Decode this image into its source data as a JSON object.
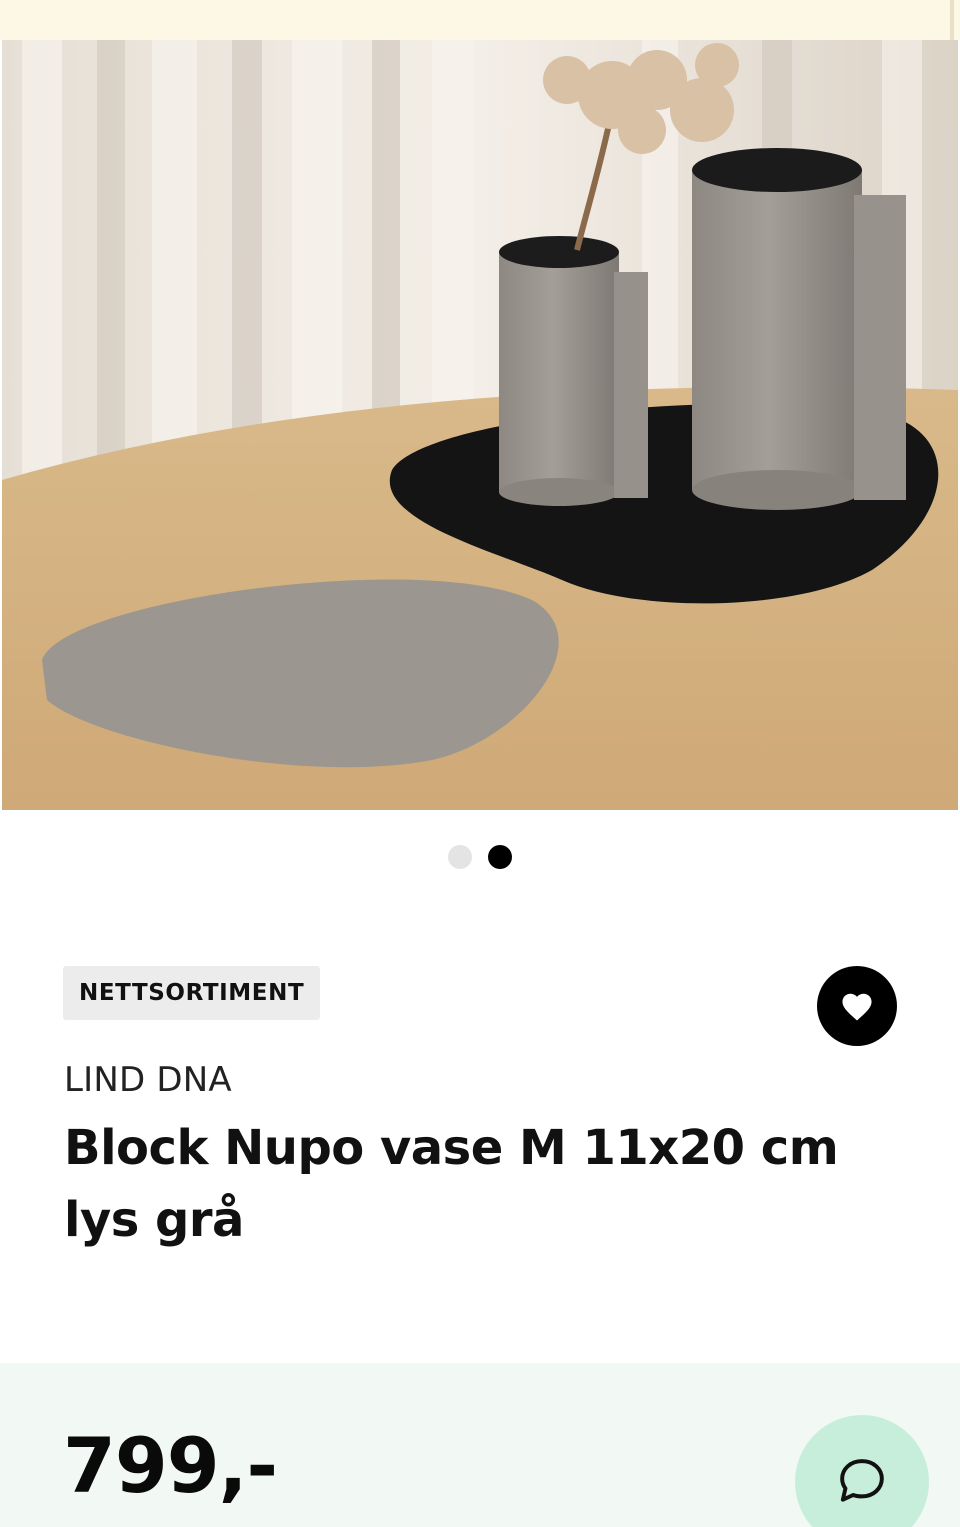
{
  "gallery": {
    "image_description_name": "product-photo",
    "slide_count": 2,
    "active_slide": 2
  },
  "product": {
    "badge": "NETTSORTIMENT",
    "brand": "LIND DNA",
    "title": "Block Nupo vase M 11x20 cm lys grå",
    "price": "799,-"
  },
  "icons": {
    "favorite": "heart-icon",
    "chat": "chat-bubble-icon"
  },
  "colors": {
    "banner": "#fdf7e6",
    "price_bar": "#f2f8f4",
    "chat_button": "#c7eedb",
    "badge_bg": "#ececec"
  }
}
